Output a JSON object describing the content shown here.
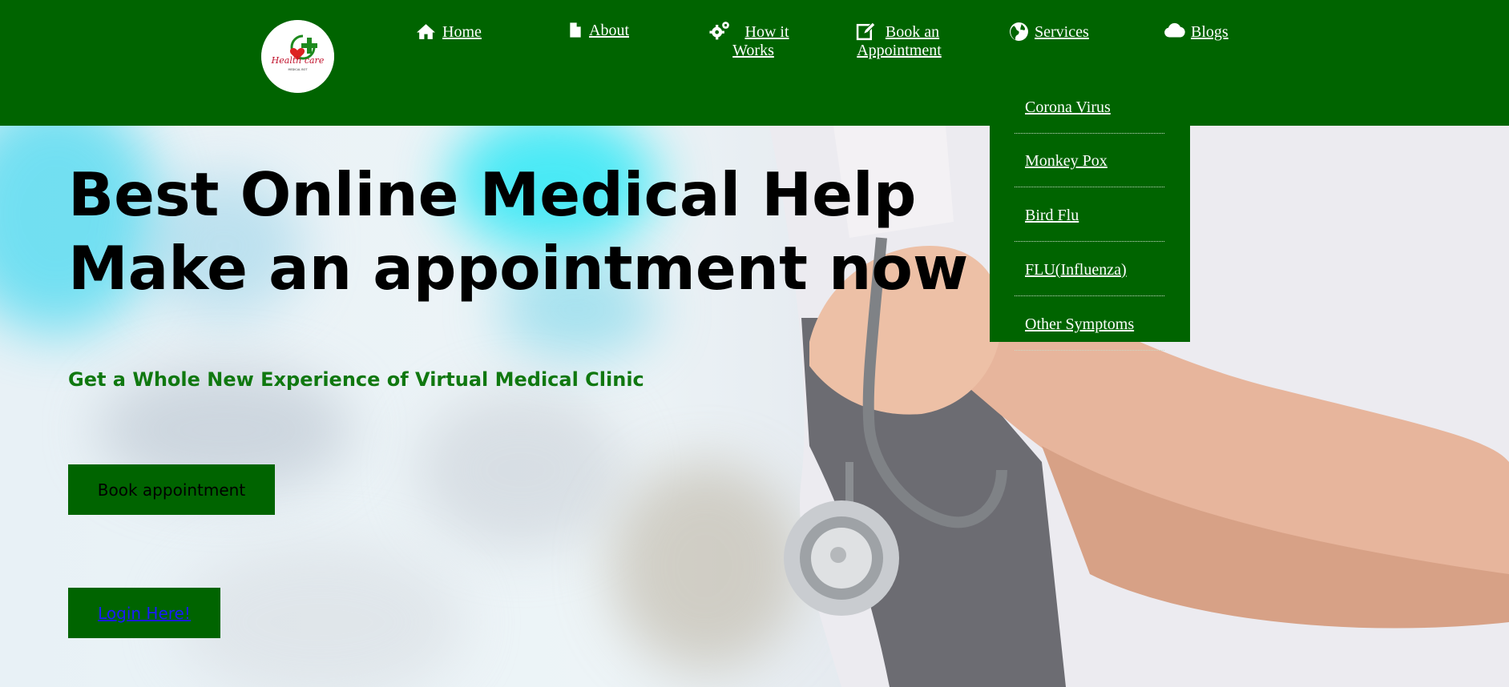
{
  "logo": {
    "text_line1": "Health care",
    "text_line2": "MEDICAL BOT"
  },
  "nav": [
    {
      "label": "Home",
      "icon": "home-icon"
    },
    {
      "label": "About",
      "icon": "file-icon"
    },
    {
      "label_line1": "How it",
      "label_line2": "Works",
      "icon": "gears-icon"
    },
    {
      "label_line1": "Book an",
      "label_line2": "Appointment",
      "icon": "edit-icon"
    },
    {
      "label": "Services",
      "icon": "globe-icon"
    },
    {
      "label": "Blogs",
      "icon": "cloud-icon"
    }
  ],
  "services_menu": [
    "Corona Virus",
    "Monkey Pox",
    "Bird Flu",
    "FLU(Influenza)",
    "Other Symptoms"
  ],
  "hero": {
    "title_line1": "Best Online Medical Help",
    "title_line2": "Make an appointment now",
    "subtitle": "Get a Whole New Experience of Virtual Medical Clinic",
    "book_button": "Book appointment",
    "login_link": "Login Here!"
  },
  "colors": {
    "header_bg": "#006400",
    "subtitle": "#107810",
    "link": "#1a1aff"
  }
}
